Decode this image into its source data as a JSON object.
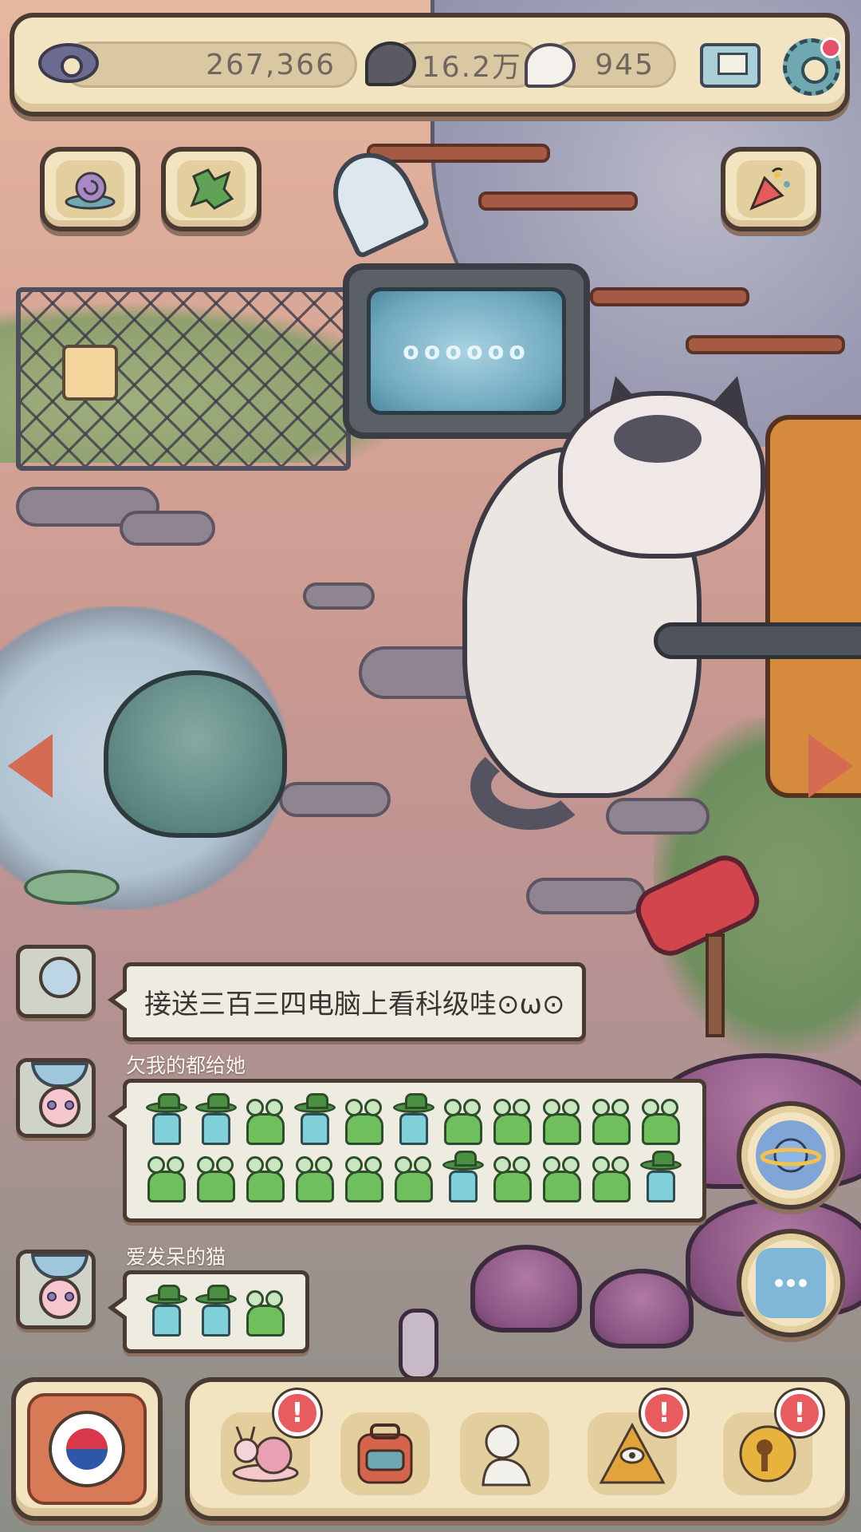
{
  "resources": {
    "eye_count": "267,366",
    "dark_bubble_count": "16.2万",
    "light_bubble_count": "945"
  },
  "scene": {
    "tv_screen_text": "oooooo"
  },
  "chat": {
    "messages": [
      {
        "sender": "",
        "text": "接送三百三四电脑上看科级哇⊙ω⊙"
      },
      {
        "sender": "欠我的都给她",
        "stickers": [
          "hat",
          "hat",
          "frog",
          "hat",
          "frog",
          "hat",
          "frog",
          "frog",
          "frog",
          "frog",
          "frog",
          "frog",
          "frog",
          "frog",
          "frog",
          "frog",
          "frog",
          "hat",
          "frog",
          "frog",
          "frog",
          "hat"
        ]
      },
      {
        "sender": "爱发呆的猫",
        "stickers": [
          "hat",
          "hat",
          "frog"
        ]
      }
    ]
  },
  "icons": {
    "top_left_tiles": [
      "snail-shell-icon",
      "map-icon"
    ],
    "top_right_tile": "party-popper-icon",
    "round_buttons": [
      "planet-icon",
      "chat-bubble-icon"
    ],
    "bottom_bar": [
      "snail-icon",
      "backpack-icon",
      "statue-icon",
      "pyramid-eye-icon",
      "key-coin-icon"
    ],
    "flag": "korea-flag-icon"
  },
  "badges": {
    "alert_symbol": "!"
  },
  "colors": {
    "panel_bg": "#f2e4c0",
    "panel_border": "#4a3b32",
    "alert_red": "#e85c60",
    "arrow_orange": "#d66b53"
  }
}
